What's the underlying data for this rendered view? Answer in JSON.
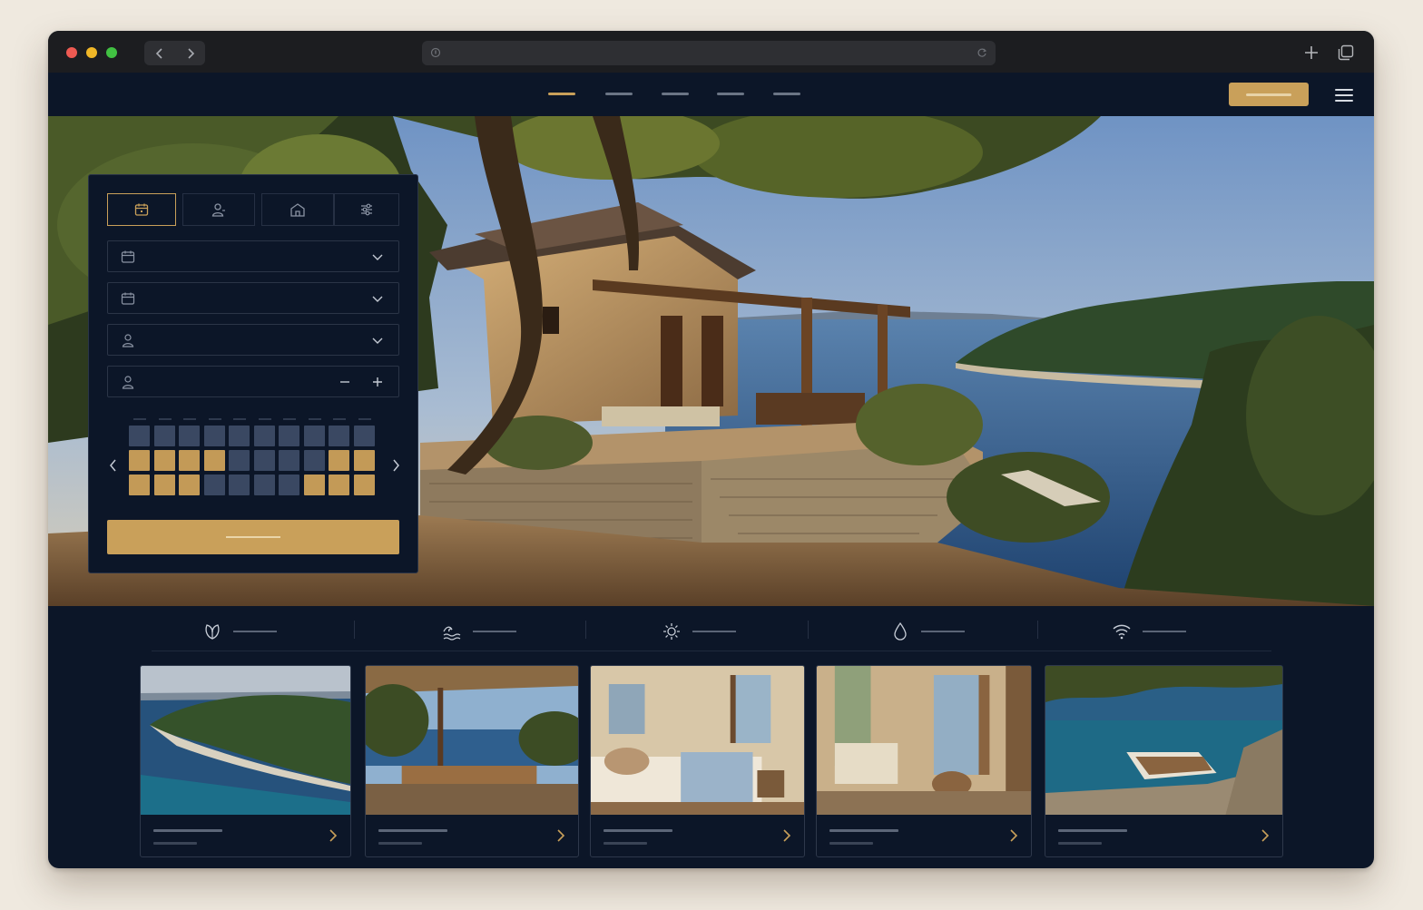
{
  "browser": {
    "back_icon": "chevron-left-icon",
    "forward_icon": "chevron-right-icon",
    "address_placeholder": "",
    "new_tab_icon": "plus-icon",
    "tabs_icon": "tabs-icon"
  },
  "nav": {
    "items": [
      "",
      "",
      "",
      "",
      ""
    ],
    "active_index": 0,
    "book_label": "",
    "menu_icon": "hamburger-icon"
  },
  "booking": {
    "tabs": [
      "calendar-icon",
      "guest-icon",
      "house-icon",
      "filters-icon"
    ],
    "active_tab": 0,
    "fields": [
      {
        "icon": "calendar-icon",
        "value": "",
        "control": "dropdown"
      },
      {
        "icon": "calendar-icon",
        "value": "",
        "control": "dropdown"
      },
      {
        "icon": "user-icon",
        "value": "",
        "control": "dropdown"
      },
      {
        "icon": "user-icon",
        "value": "",
        "control": "stepper"
      }
    ],
    "calendar": {
      "rows": [
        [
          "free",
          "free",
          "free",
          "free",
          "free",
          "free",
          "free",
          "free",
          "free",
          "free"
        ],
        [
          "sel",
          "sel",
          "sel",
          "sel",
          "free",
          "free",
          "free",
          "free",
          "sel",
          "sel"
        ],
        [
          "sel",
          "sel",
          "sel",
          "free",
          "free",
          "free",
          "free",
          "sel",
          "sel",
          "sel"
        ]
      ]
    },
    "search_label": ""
  },
  "features": [
    {
      "icon": "leaf-icon",
      "label": ""
    },
    {
      "icon": "waves-icon",
      "label": ""
    },
    {
      "icon": "sun-icon",
      "label": ""
    },
    {
      "icon": "water-drop-icon",
      "label": ""
    },
    {
      "icon": "wifi-icon",
      "label": ""
    }
  ],
  "gallery": [
    {
      "scene": "aerial-island",
      "title": "",
      "subtitle": ""
    },
    {
      "scene": "terrace-dining",
      "title": "",
      "subtitle": ""
    },
    {
      "scene": "bedroom",
      "title": "",
      "subtitle": ""
    },
    {
      "scene": "living-room",
      "title": "",
      "subtitle": ""
    },
    {
      "scene": "boat-cove",
      "title": "",
      "subtitle": ""
    }
  ],
  "colors": {
    "navy": "#0c1628",
    "gold": "#c9a05a",
    "chrome": "#1c1d20"
  }
}
